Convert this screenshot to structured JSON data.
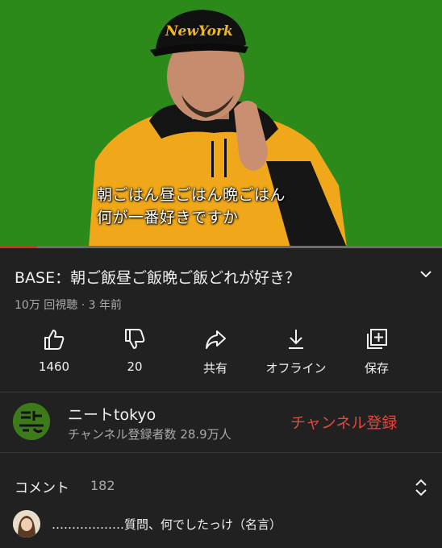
{
  "video": {
    "subtitle_line1": "朝ごはん昼ごはん晩ごはん",
    "subtitle_line2": "何が一番好きですか",
    "cap_text": "NewYork",
    "progress_fraction": 0.084
  },
  "info": {
    "title": "BASE：朝ご飯昼ご飯晩ご飯どれが好き？",
    "views": "10万 回視聴 · 3 年前"
  },
  "actions": [
    {
      "label": "1460",
      "icon": "thumbs-up-icon"
    },
    {
      "label": "20",
      "icon": "thumbs-down-icon"
    },
    {
      "label": "共有",
      "icon": "share-icon"
    },
    {
      "label": "オフライン",
      "icon": "download-icon"
    },
    {
      "label": "保存",
      "icon": "add-to-playlist-icon"
    }
  ],
  "channel": {
    "name": "ニートtokyo",
    "subscribers": "チャンネル登録者数 28.9万人",
    "subscribe_label": "チャンネル登録",
    "subscribe_color": "#e5483a"
  },
  "comments": {
    "label": "コメント",
    "count": "182",
    "top_comment": "………………質問、何でしたっけ（名言）"
  }
}
